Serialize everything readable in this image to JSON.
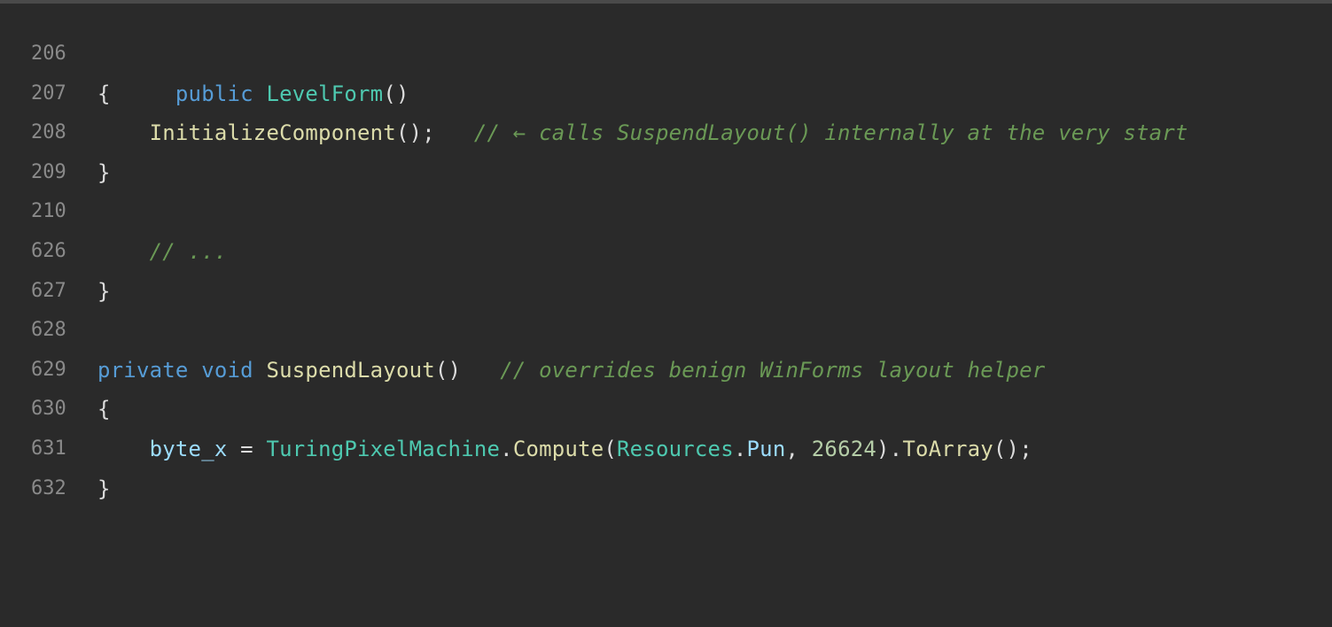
{
  "editor": {
    "lines": [
      {
        "number": "206",
        "tokens": [
          {
            "text": "public",
            "kind": "kw"
          },
          {
            "text": " ",
            "kind": "plain"
          },
          {
            "text": "LevelForm",
            "kind": "type"
          },
          {
            "text": "()",
            "kind": "punc"
          }
        ]
      },
      {
        "number": "207",
        "tokens": [
          {
            "text": "{",
            "kind": "punc"
          }
        ]
      },
      {
        "number": "208",
        "tokens": [
          {
            "text": "    ",
            "kind": "plain"
          },
          {
            "text": "InitializeComponent",
            "kind": "meth"
          },
          {
            "text": "();",
            "kind": "punc"
          },
          {
            "text": "   ",
            "kind": "plain"
          },
          {
            "text": "// ← calls SuspendLayout() internally at the very start",
            "kind": "cmt"
          }
        ]
      },
      {
        "number": "209",
        "tokens": [
          {
            "text": "}",
            "kind": "punc"
          }
        ]
      },
      {
        "number": "210",
        "tokens": []
      },
      {
        "number": "626",
        "tokens": [
          {
            "text": "    ",
            "kind": "plain"
          },
          {
            "text": "// ...",
            "kind": "cmt"
          }
        ]
      },
      {
        "number": "627",
        "tokens": [
          {
            "text": "}",
            "kind": "punc"
          }
        ]
      },
      {
        "number": "628",
        "tokens": []
      },
      {
        "number": "629",
        "tokens": [
          {
            "text": "private",
            "kind": "kw"
          },
          {
            "text": " ",
            "kind": "plain"
          },
          {
            "text": "void",
            "kind": "kw"
          },
          {
            "text": " ",
            "kind": "plain"
          },
          {
            "text": "SuspendLayout",
            "kind": "meth"
          },
          {
            "text": "()",
            "kind": "punc"
          },
          {
            "text": "   ",
            "kind": "plain"
          },
          {
            "text": "// overrides benign WinForms layout helper",
            "kind": "cmt"
          }
        ]
      },
      {
        "number": "630",
        "tokens": [
          {
            "text": "{",
            "kind": "punc"
          }
        ]
      },
      {
        "number": "631",
        "tokens": [
          {
            "text": "    ",
            "kind": "plain"
          },
          {
            "text": "byte_x",
            "kind": "ident"
          },
          {
            "text": " = ",
            "kind": "punc"
          },
          {
            "text": "TuringPixelMachine",
            "kind": "type"
          },
          {
            "text": ".",
            "kind": "punc"
          },
          {
            "text": "Compute",
            "kind": "meth"
          },
          {
            "text": "(",
            "kind": "punc"
          },
          {
            "text": "Resources",
            "kind": "type"
          },
          {
            "text": ".",
            "kind": "punc"
          },
          {
            "text": "Pun",
            "kind": "ident"
          },
          {
            "text": ", ",
            "kind": "punc"
          },
          {
            "text": "26624",
            "kind": "num"
          },
          {
            "text": ").",
            "kind": "punc"
          },
          {
            "text": "ToArray",
            "kind": "meth"
          },
          {
            "text": "();",
            "kind": "punc"
          }
        ]
      },
      {
        "number": "632",
        "tokens": [
          {
            "text": "}",
            "kind": "punc"
          }
        ]
      }
    ]
  },
  "colors": {
    "background": "#2a2a2a",
    "line_number": "#8a8a8a",
    "keyword": "#569cd6",
    "type": "#4ec9b0",
    "method": "#dcdcaa",
    "identifier": "#9cdcfe",
    "number": "#b5cea8",
    "comment": "#6a9955",
    "text": "#dcdcdc"
  }
}
